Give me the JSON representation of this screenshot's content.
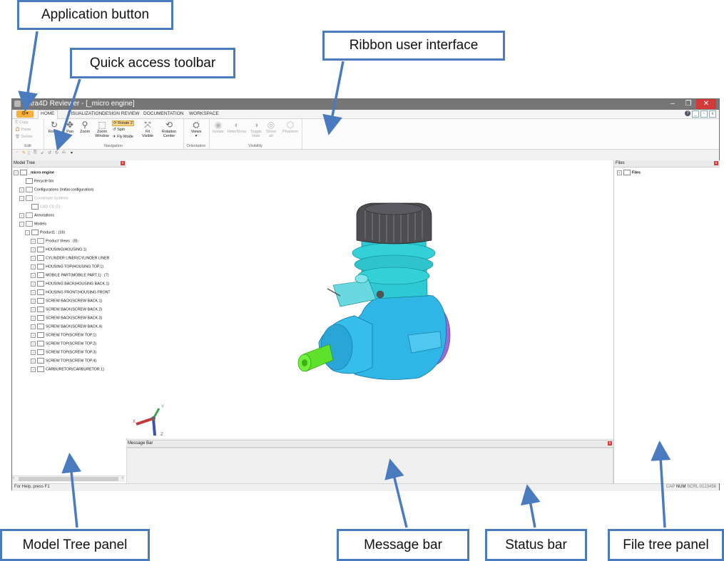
{
  "callouts": {
    "application_button": "Application button",
    "quick_access_toolbar": "Quick access toolbar",
    "ribbon_ui": "Ribbon user interface",
    "model_tree_panel": "Model Tree panel",
    "message_bar": "Message bar",
    "status_bar": "Status bar",
    "file_tree_panel": "File tree panel"
  },
  "window": {
    "title": "Ultra4D Reviewer - [_micro engine]",
    "minimize": "–",
    "restore": "❐",
    "close": "✕"
  },
  "tabs": [
    "HOME",
    "VISUALIZATION",
    "DESIGN REVIEW",
    "DOCUMENTATION",
    "WORKSPACE"
  ],
  "ribbon": {
    "edit": {
      "label": "Edit",
      "copy": "Copy",
      "paste": "Paste",
      "delete": "Delete"
    },
    "navigation": {
      "label": "Navigation",
      "rotate": "Rotate",
      "pan": "Pan",
      "zoom": "Zoom",
      "zoom_window_1": "Zoom",
      "zoom_window_2": "Window",
      "rotate2": "Rotate 2",
      "spin": "Spin",
      "fly_mode": "Fly Mode",
      "fit_1": "Fit",
      "fit_2": "Visible",
      "rot_center_1": "Rotation",
      "rot_center_2": "Center"
    },
    "orientation": {
      "label": "Orientation",
      "views": "Views"
    },
    "visibility": {
      "label": "Visibility",
      "isolate": "Isolate",
      "hide_show": "Hide/Show",
      "toggle_1": "Toggle",
      "toggle_2": "Hide",
      "show_1": "Show",
      "show_2": "all",
      "phantom": "Phantom"
    }
  },
  "model_tree": {
    "title": "Model Tree",
    "items": [
      "_micro engine",
      "Recycle bin",
      "Configurations (Initial configuration)",
      "Coordinate Systems",
      "CAD CS (Z)",
      "Annotations",
      "Models",
      "Product1 : (16)",
      "Product Views : (8)",
      "HOUSING(HOUSING.1)",
      "CYLINDER LINER(CYLINDER LINER",
      "HOUSING TOP(HOUSING TOP.1)",
      "MOBILE PART(MOBILE PART.1) : (7)",
      "HOUSING BACK(HOUSING BACK.1)",
      "HOUSING FRONT(HOUSING FRONT",
      "SCREW BACK(SCREW BACK.1)",
      "SCREW BACK(SCREW BACK.2)",
      "SCREW BACK(SCREW BACK.3)",
      "SCREW BACK(SCREW BACK.4)",
      "SCREW TOP(SCREW TOP.1)",
      "SCREW TOP(SCREW TOP.2)",
      "SCREW TOP(SCREW TOP.3)",
      "SCREW TOP(SCREW TOP.4)",
      "CARBURETOR(CARBURETOR.1)"
    ]
  },
  "viewport": {
    "axis_y": "Y",
    "axis_x": "X",
    "axis_z": "Z"
  },
  "message_bar": {
    "title": "Message Bar"
  },
  "files": {
    "title": "Files",
    "root": "Files"
  },
  "status_bar": {
    "left": "For Help, press F1",
    "cap": "CAP",
    "num": "NUM",
    "scrl": "SCRL",
    "code": "0123456"
  },
  "colors": {
    "accent": "#4a7bbf",
    "app_button": "#f7b03e",
    "engine_body": "#2fb5e6",
    "engine_head": "#4d4d52",
    "engine_green": "#5fe02a",
    "engine_purple": "#9a6ad8"
  }
}
